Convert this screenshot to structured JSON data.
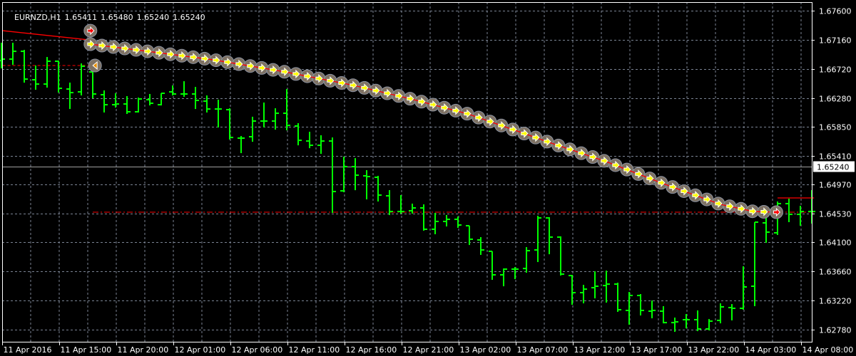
{
  "header": {
    "symbol_timeframe": "EURNZD,H1",
    "open": "1.65411",
    "high": "1.65480",
    "low": "1.65240",
    "close": "1.65240"
  },
  "colors": {
    "background": "#000000",
    "grid": "#7b8494",
    "bars": "#00ff00",
    "indicator_line": "#ff0000",
    "circle": "#7e7264",
    "arrow_yellow": "#ffff00",
    "arrow_red": "#ff0000",
    "arrow_orange": "#e8900a",
    "axis_text": "#ffffff",
    "bid_line": "#a0a0a0"
  },
  "price_axis": {
    "max": 1.676,
    "price_per_pixel": 0.0001076,
    "labels": [
      "1.67600",
      "1.67160",
      "1.66720",
      "1.66280",
      "1.65850",
      "1.65410",
      "1.64970",
      "1.64530",
      "1.64100",
      "1.63660",
      "1.63220",
      "1.62780"
    ],
    "bid_label": "1.65240"
  },
  "time_axis": {
    "labels": [
      "11 Apr 2016",
      "11 Apr 15:00",
      "11 Apr 20:00",
      "12 Apr 01:00",
      "12 Apr 06:00",
      "12 Apr 11:00",
      "12 Apr 16:00",
      "12 Apr 21:00",
      "13 Apr 02:00",
      "13 Apr 07:00",
      "13 Apr 12:00",
      "13 Apr 17:00",
      "13 Apr 22:00",
      "14 Apr 03:00",
      "14 Apr 08:00"
    ],
    "bars_per_label": 5
  },
  "bars_ohlc": [
    [
      1.66846,
      1.67115,
      1.66739,
      1.66868
    ],
    [
      1.66868,
      1.67115,
      1.66793,
      1.66986
    ],
    [
      1.66986,
      1.67008,
      1.66523,
      1.66566
    ],
    [
      1.66556,
      1.66771,
      1.66416,
      1.66491
    ],
    [
      1.66491,
      1.669,
      1.66448,
      1.66836
    ],
    [
      1.66836,
      1.66846,
      1.66373,
      1.66427
    ],
    [
      1.66416,
      1.66513,
      1.66125,
      1.66362
    ],
    [
      1.66373,
      1.66803,
      1.6633,
      1.6676
    ],
    [
      1.66674,
      1.66685,
      1.66287,
      1.66341
    ],
    [
      1.6633,
      1.66395,
      1.66072,
      1.66179
    ],
    [
      1.66179,
      1.66352,
      1.66147,
      1.6619
    ],
    [
      1.6619,
      1.66309,
      1.6605,
      1.66072
    ],
    [
      1.66072,
      1.66287,
      1.66072,
      1.66266
    ],
    [
      1.66255,
      1.66341,
      1.66179,
      1.66201
    ],
    [
      1.66179,
      1.66352,
      1.66179,
      1.66352
    ],
    [
      1.66373,
      1.6647,
      1.6633,
      1.66341
    ],
    [
      1.66341,
      1.66534,
      1.66309,
      1.66341
    ],
    [
      1.66341,
      1.66448,
      1.66125,
      1.66244
    ],
    [
      1.66233,
      1.66319,
      1.66072,
      1.66114
    ],
    [
      1.66114,
      1.66255,
      1.65846,
      1.66114
    ],
    [
      1.66104,
      1.66125,
      1.65663,
      1.65684
    ],
    [
      1.65674,
      1.65706,
      1.65458,
      1.65674
    ],
    [
      1.65695,
      1.65997,
      1.6563,
      1.65932
    ],
    [
      1.65932,
      1.66212,
      1.65846,
      1.65932
    ],
    [
      1.65932,
      1.66125,
      1.65813,
      1.6605
    ],
    [
      1.6605,
      1.66416,
      1.65803,
      1.65867
    ],
    [
      1.65857,
      1.659,
      1.65576,
      1.65641
    ],
    [
      1.6563,
      1.6577,
      1.65533,
      1.65566
    ],
    [
      1.65566,
      1.65717,
      1.65447,
      1.6563
    ],
    [
      1.6563,
      1.65684,
      1.64555,
      1.64867
    ],
    [
      1.64877,
      1.65394,
      1.64867,
      1.65243
    ],
    [
      1.65243,
      1.65372,
      1.64898,
      1.65114
    ],
    [
      1.65104,
      1.6519,
      1.64759,
      1.65093
    ],
    [
      1.65082,
      1.65104,
      1.64727,
      1.64813
    ],
    [
      1.64802,
      1.64888,
      1.64522,
      1.64565
    ],
    [
      1.64565,
      1.64813,
      1.64544,
      1.64565
    ],
    [
      1.64576,
      1.64684,
      1.64544,
      1.64619
    ],
    [
      1.64619,
      1.64673,
      1.64286,
      1.64297
    ],
    [
      1.64297,
      1.64544,
      1.64232,
      1.64415
    ],
    [
      1.64415,
      1.64512,
      1.6435,
      1.64447
    ],
    [
      1.64447,
      1.6449,
      1.64329,
      1.64361
    ],
    [
      1.6435,
      1.6435,
      1.6407,
      1.64146
    ],
    [
      1.64135,
      1.64178,
      1.6392,
      1.63984
    ],
    [
      1.63963,
      1.63963,
      1.63543,
      1.63608
    ],
    [
      1.63608,
      1.63704,
      1.63446,
      1.63694
    ],
    [
      1.63694,
      1.63726,
      1.63554,
      1.63694
    ],
    [
      1.63704,
      1.64027,
      1.63651,
      1.63973
    ],
    [
      1.63984,
      1.64501,
      1.63812,
      1.64468
    ],
    [
      1.64468,
      1.64479,
      1.6393,
      1.64178
    ],
    [
      1.64178,
      1.64189,
      1.63608,
      1.63619
    ],
    [
      1.63597,
      1.63608,
      1.63166,
      1.63339
    ],
    [
      1.63339,
      1.63457,
      1.63188,
      1.63392
    ],
    [
      1.63414,
      1.63661,
      1.63263,
      1.63436
    ],
    [
      1.63446,
      1.63672,
      1.63199,
      1.63468
    ],
    [
      1.63468,
      1.63489,
      1.63059,
      1.63081
    ],
    [
      1.6307,
      1.63349,
      1.62865,
      1.63296
    ],
    [
      1.63296,
      1.63317,
      1.63005,
      1.6307
    ],
    [
      1.63059,
      1.6322,
      1.62962,
      1.6307
    ],
    [
      1.63059,
      1.63134,
      1.62886,
      1.62886
    ],
    [
      1.62886,
      1.62962,
      1.62757,
      1.62897
    ],
    [
      1.6293,
      1.63016,
      1.62811,
      1.6293
    ],
    [
      1.6293,
      1.6307,
      1.62768,
      1.6279
    ],
    [
      1.6279,
      1.6294,
      1.62779,
      1.62908
    ],
    [
      1.62919,
      1.63177,
      1.62886,
      1.63124
    ],
    [
      1.63113,
      1.63166,
      1.6293,
      1.63102
    ],
    [
      1.63102,
      1.63737,
      1.63091,
      1.63425
    ],
    [
      1.63436,
      1.64404,
      1.63145,
      1.64404
    ],
    [
      1.64393,
      1.64641,
      1.64103,
      1.64253
    ],
    [
      1.64243,
      1.64716,
      1.64221,
      1.64684
    ],
    [
      1.64684,
      1.64759,
      1.64415,
      1.64522
    ],
    [
      1.64522,
      1.64651,
      1.64361,
      1.64565
    ],
    [
      1.64565,
      1.64888,
      1.64393,
      1.64565
    ]
  ],
  "indicator": {
    "lead_line": [
      [
        0.1,
        1.67298
      ],
      [
        7.7,
        1.67158
      ]
    ],
    "path": [
      [
        7.8,
        1.67094
      ],
      [
        12.8,
        1.66986
      ],
      [
        18.6,
        1.66857
      ],
      [
        24.9,
        1.66674
      ],
      [
        30.9,
        1.6647
      ],
      [
        35.9,
        1.66266
      ],
      [
        40.9,
        1.66039
      ],
      [
        45.9,
        1.65738
      ],
      [
        48,
        1.65609
      ],
      [
        53,
        1.65319
      ],
      [
        58,
        1.64985
      ],
      [
        63,
        1.64673
      ],
      [
        65.9,
        1.64565
      ],
      [
        67.9,
        1.64555
      ]
    ],
    "tail_line": [
      [
        68,
        1.6477
      ],
      [
        71.2,
        1.6477
      ]
    ],
    "yellow_arrow_start": 7.8,
    "yellow_arrow_count": 60,
    "red_arrow_start": [
      7.8,
      1.67298
    ],
    "red_arrow_end": [
      67.9,
      1.64555
    ],
    "orange_arrow": [
      8.2,
      1.66771
    ],
    "dashed_level": {
      "price": 1.66771,
      "from": 0.1,
      "to": 7.7
    },
    "dashdot_level": {
      "price": 1.64555,
      "from": 8,
      "to": 71.2
    }
  },
  "bid_price": 1.6524
}
